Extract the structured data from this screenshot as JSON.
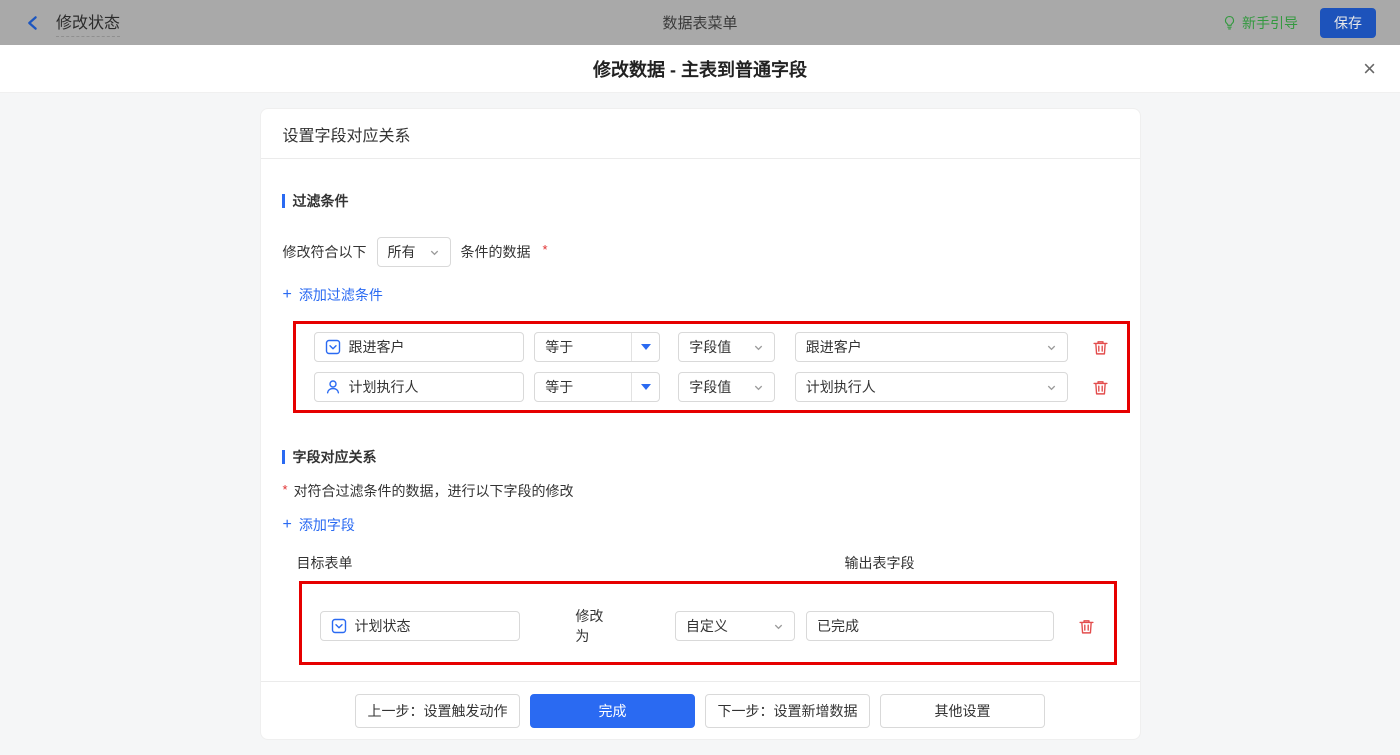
{
  "topbar": {
    "back_title": "修改状态",
    "center_title": "数据表菜单",
    "guide_label": "新手引导",
    "save_label": "保存"
  },
  "modal": {
    "title": "修改数据 - 主表到普通字段",
    "close_glyph": "×"
  },
  "card": {
    "header": "设置字段对应关系",
    "filter": {
      "title": "过滤条件",
      "match_prefix": "修改符合以下",
      "match_select_value": "所有",
      "match_suffix": "条件的数据",
      "required_mark": "*",
      "add_plus": "+",
      "add_label": "添加过滤条件",
      "rows": [
        {
          "field": "跟进客户",
          "field_icon": "select-field-icon",
          "operator": "等于",
          "value_type": "字段值",
          "value": "跟进客户"
        },
        {
          "field": "计划执行人",
          "field_icon": "user-field-icon",
          "operator": "等于",
          "value_type": "字段值",
          "value": "计划执行人"
        }
      ]
    },
    "mapping": {
      "title": "字段对应关系",
      "required_mark": "*",
      "description": "对符合过滤条件的数据，进行以下字段的修改",
      "add_plus": "+",
      "add_label": "添加字段",
      "col_target": "目标表单",
      "col_output": "输出表字段",
      "rows": [
        {
          "field": "计划状态",
          "field_icon": "select-field-icon",
          "modify_label": "修改为",
          "mode": "自定义",
          "custom_value": "已完成"
        }
      ]
    },
    "footer": {
      "prev_label": "上一步：设置触发动作",
      "done_label": "完成",
      "next_label": "下一步：设置新增数据",
      "other_label": "其他设置"
    }
  },
  "colors": {
    "accent_blue": "#2a6af2",
    "highlight_red": "#e60000",
    "danger_red": "#e34d4d",
    "guide_green": "#33993f",
    "topbar_gray": "#a9a9a9"
  }
}
